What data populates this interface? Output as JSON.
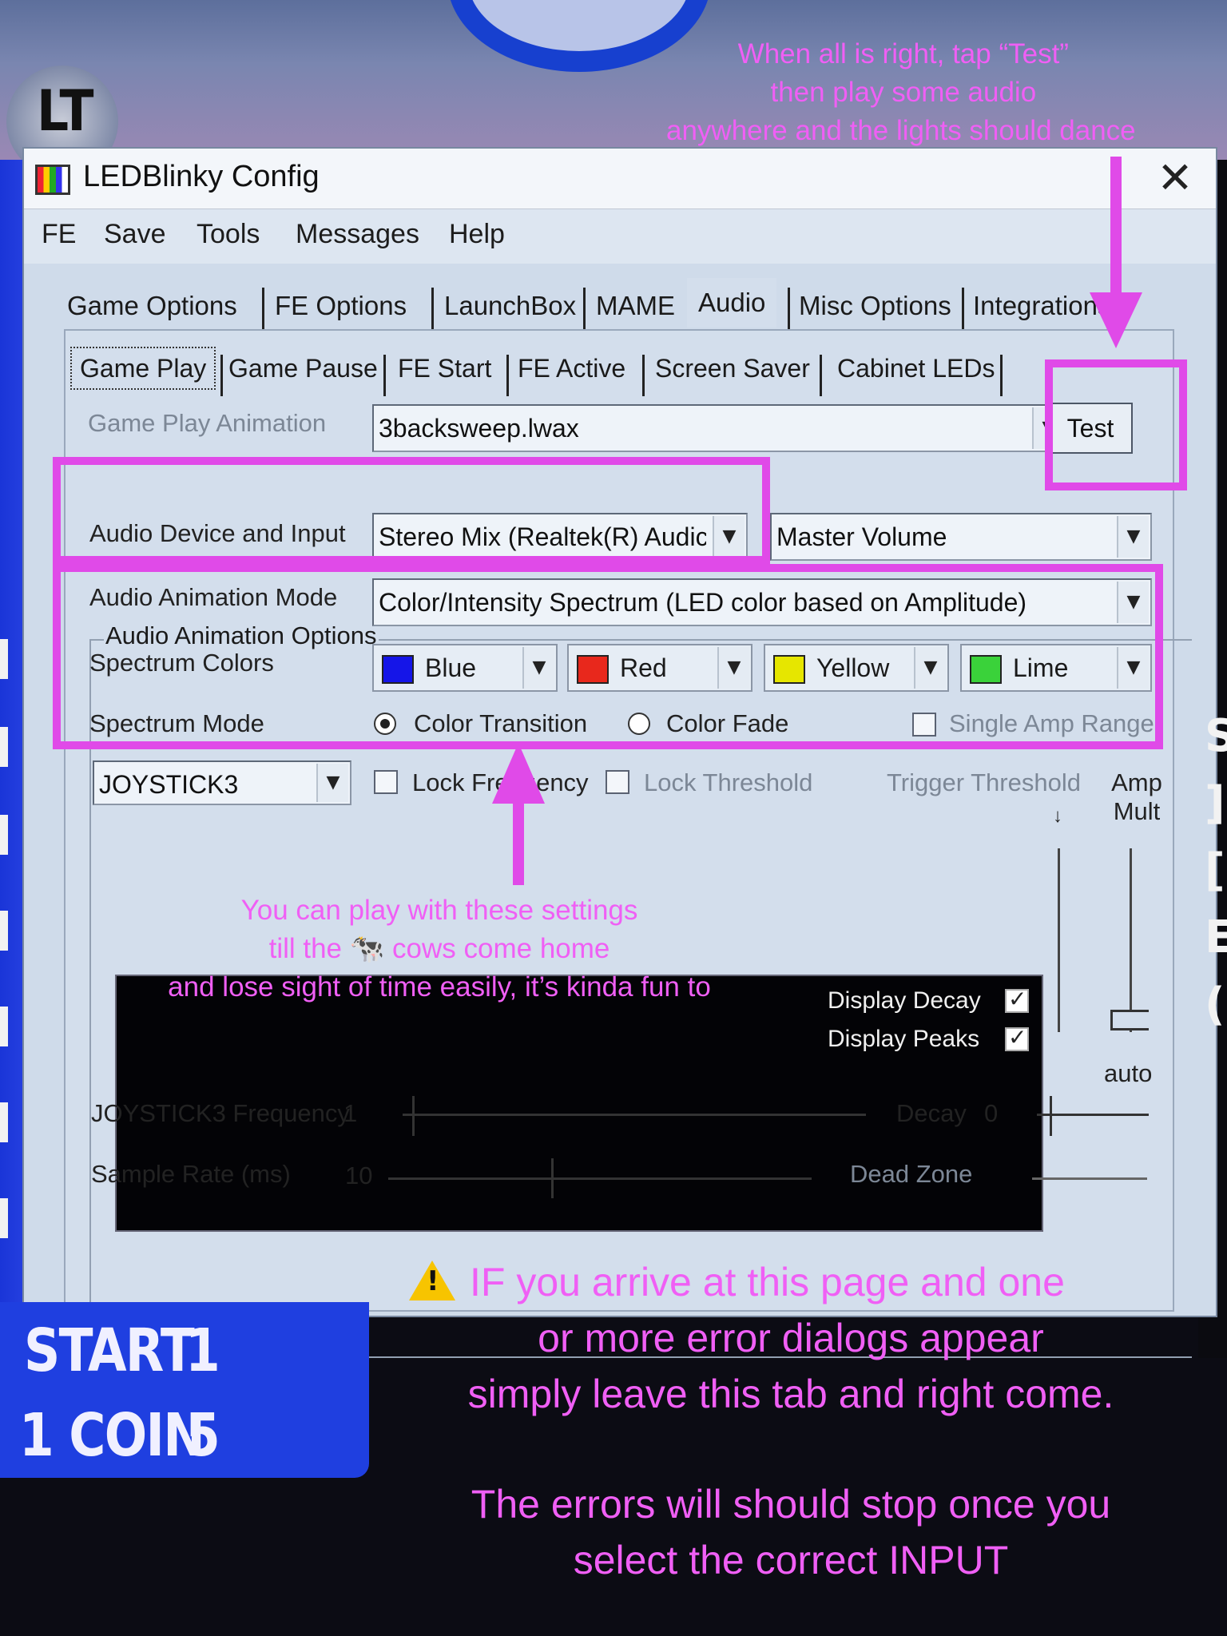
{
  "background": {
    "lt_label": "LT",
    "arcade_start": "START",
    "arcade_start_num": "1",
    "arcade_coin": "1 COIN",
    "arcade_coin_num": "5"
  },
  "window": {
    "title": "LEDBlinky Config",
    "close_glyph": "✕"
  },
  "menu": [
    "FE",
    "Save",
    "Tools",
    "Messages",
    "Help"
  ],
  "main_tabs": [
    "Game Options",
    "FE Options",
    "LaunchBox",
    "MAME",
    "Audio",
    "Misc Options",
    "Integrations"
  ],
  "main_tabs_active": "Audio",
  "sub_tabs": [
    "Game Play",
    "Game Pause",
    "FE Start",
    "FE Active",
    "Screen Saver",
    "Cabinet LEDs"
  ],
  "sub_tabs_active": "Game Play",
  "form": {
    "animation_label": "Game Play Animation",
    "animation_value": "3backsweep.lwax",
    "test_label": "Test",
    "group_title": "Audio Animation Options",
    "device_label": "Audio Device and Input",
    "device_value": "Stereo Mix (Realtek(R) Audic",
    "input_value": "Master Volume",
    "mode_label": "Audio Animation Mode",
    "mode_value": "Color/Intensity Spectrum (LED color based on Amplitude)",
    "spectrum_colors_label": "Spectrum Colors",
    "spectrum_colors": [
      {
        "name": "Blue",
        "swatch": "#1515e8"
      },
      {
        "name": "Red",
        "swatch": "#e8281c"
      },
      {
        "name": "Yellow",
        "swatch": "#e6e600"
      },
      {
        "name": "Lime",
        "swatch": "#3ad23a"
      }
    ],
    "spectrum_mode_label": "Spectrum Mode",
    "color_transition_label": "Color Transition",
    "color_fade_label": "Color Fade",
    "single_amp_label": "Single Amp Range",
    "joystick_value": "JOYSTICK3",
    "lock_frequency_label": "Lock Frequency",
    "lock_threshold_label": "Lock Threshold",
    "trigger_threshold_label": "Trigger Threshold",
    "amp_mult_label": "Amp Mult",
    "display_decay_label": "Display Decay",
    "display_peaks_label": "Display Peaks",
    "auto_label": "auto",
    "frequency_label": "JOYSTICK3 Frequency",
    "frequency_value": "1",
    "decay_label": "Decay",
    "decay_value": "0",
    "sample_rate_label": "Sample Rate (ms)",
    "sample_rate_value": "10",
    "dead_zone_label": "Dead Zone"
  },
  "annotations": {
    "top_line1": "When all is right, tap “Test”",
    "top_line2": "then play some audio",
    "top_line3": "anywhere and the lights should dance",
    "mid_line1": "You can play with these settings",
    "mid_line2": "till the 🐄 cows come home",
    "mid_line3": "and lose sight of time easily, it’s kinda fun to",
    "warn_line1": "IF you arrive at this page and one",
    "warn_line2": "or more error dialogs appear",
    "warn_line3": "simply leave this tab and right come.",
    "bottom_line1": "The errors will should stop once you",
    "bottom_line2": "select the correct INPUT",
    "color": "#f05ff5"
  },
  "edge_text": "S\n]\n[\nE\n("
}
